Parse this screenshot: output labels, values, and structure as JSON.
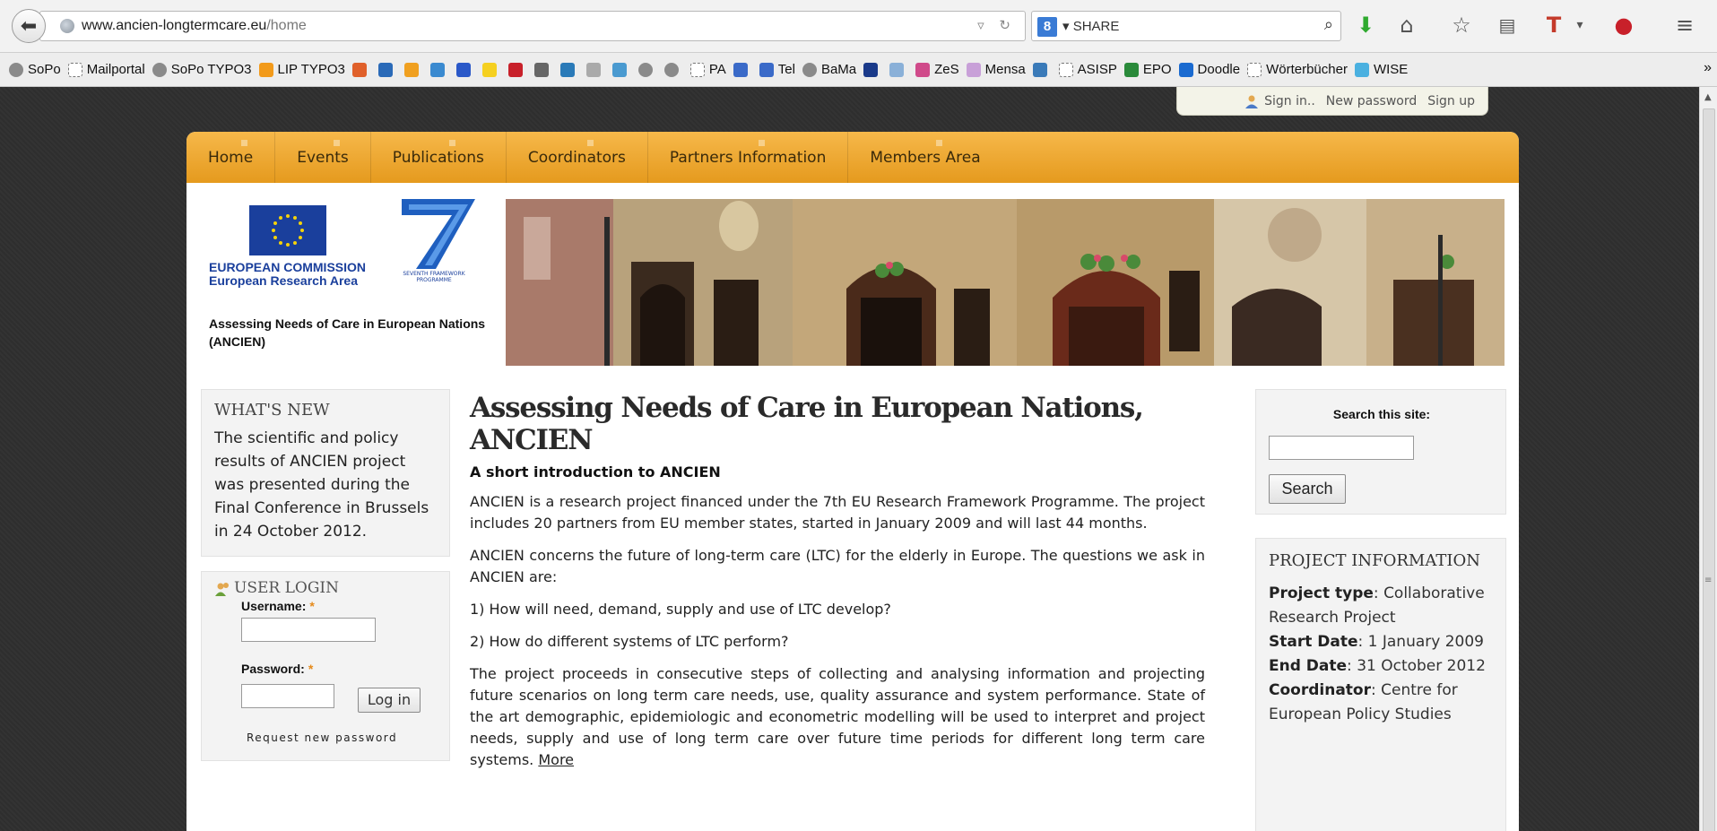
{
  "browser": {
    "url_host": "www.ancien-longtermcare.eu",
    "url_path": "/home",
    "search_engine_label": "SHARE",
    "bookmarks": [
      "SoPo",
      "Mailportal",
      "SoPo TYPO3",
      "LIP TYPO3",
      "PA",
      "Tel",
      "BaMa",
      "ZeS",
      "Mensa",
      "ASISP",
      "EPO",
      "Doodle",
      "Wörterbücher",
      "WISE"
    ],
    "bookmarks_more": "»"
  },
  "account": {
    "sign_in": "Sign in..",
    "new_password": "New password",
    "sign_up": "Sign up"
  },
  "nav": {
    "items": [
      "Home",
      "Events",
      "Publications",
      "Coordinators",
      "Partners Information",
      "Members Area"
    ]
  },
  "header": {
    "ec_line1": "EUROPEAN COMMISSION",
    "ec_line2": "European Research Area",
    "fp7_line1": "SEVENTH FRAMEWORK",
    "fp7_line2": "PROGRAMME",
    "site_name_line1": "Assessing Needs of Care in European Nations",
    "site_name_line2": "(ANCIEN)"
  },
  "whats_new": {
    "title": "WHAT'S NEW",
    "text": "The scientific and policy results of ANCIEN project was presented during the Final Conference in Brussels in 24 October 2012."
  },
  "user_login": {
    "title": "USER LOGIN",
    "username_label": "Username:",
    "password_label": "Password:",
    "required_mark": "*",
    "login_button": "Log in",
    "request_password": "Request new password"
  },
  "main": {
    "title": "Assessing Needs of Care in European Nations, ANCIEN",
    "subtitle": "A short introduction to ANCIEN",
    "p1": "ANCIEN is a research project financed under the 7th EU Research Framework Programme. The project includes 20 partners from EU member states, started in January 2009 and will last 44 months.",
    "p2": "ANCIEN concerns the future of long-term care (LTC) for the elderly in Europe. The questions we ask in ANCIEN are:",
    "q1": "1) How will need, demand, supply and use of LTC develop?",
    "q2": "2) How do different systems of LTC perform?",
    "p3": "The project proceeds in consecutive steps of collecting and analysing information and projecting future scenarios on long term care needs, use, quality assurance and system performance. State of the art demographic, epidemiologic and econometric modelling will be used to interpret and project needs, supply and use of long term care over future time periods for different long term care systems.",
    "more_link": "More"
  },
  "search": {
    "label": "Search this site:",
    "button": "Search"
  },
  "project_info": {
    "title": "PROJECT INFORMATION",
    "type_label": "Project type",
    "type_value": "Collaborative Research Project",
    "start_label": "Start Date",
    "start_value": "1 January 2009",
    "end_label": "End Date",
    "end_value": "31 October 2012",
    "coord_label": "Coordinator",
    "coord_value": "Centre for European Policy Studies"
  }
}
